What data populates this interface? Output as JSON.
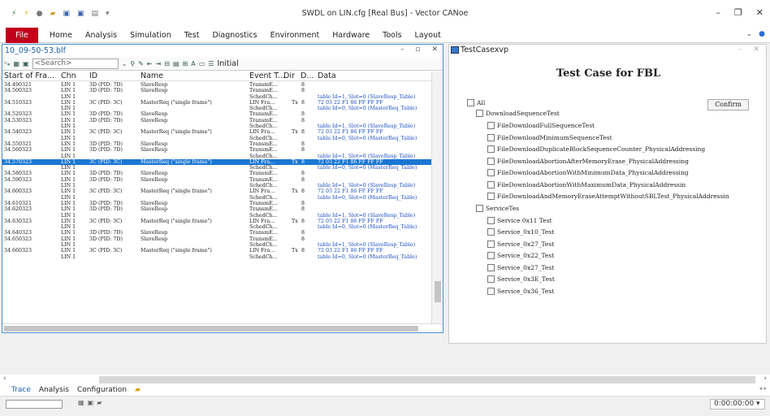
{
  "window": {
    "title": "SWDL on LIN.cfg [Real Bus] - Vector CANoe"
  },
  "menu": [
    "File",
    "Home",
    "Analysis",
    "Simulation",
    "Test",
    "Diagnostics",
    "Environment",
    "Hardware",
    "Tools",
    "Layout"
  ],
  "trace": {
    "title": "10_09-50-53.blf",
    "search_placeholder": "<Search>",
    "initial_label": "Initial",
    "columns": [
      "Start of Fra...",
      "Chn",
      "ID",
      "Name",
      "Event T...",
      "Dir",
      "D...",
      "Data"
    ],
    "rows": [
      {
        "t": "34.490321",
        "chn": "LIN 1",
        "id": "3D (PID: 7D)",
        "name": "SlaveResp",
        "evt": "TransmE...",
        "dir": "",
        "dlc": "8",
        "data": ""
      },
      {
        "t": "34.500323",
        "chn": "LIN 1",
        "id": "3D (PID: 7D)",
        "name": "SlaveResp",
        "evt": "TransmE...",
        "dir": "",
        "dlc": "8",
        "data": ""
      },
      {
        "t": "",
        "chn": "LIN 1",
        "id": "",
        "name": "",
        "evt": "SchedCh...",
        "dir": "",
        "dlc": "",
        "data": "table Id=1, Slot=0 (SlaveResp_Table)"
      },
      {
        "t": "34.510323",
        "chn": "LIN 1",
        "id": "3C (PID: 3C)",
        "name": "MasterReq (\"single frame\")",
        "evt": "LIN Fra...",
        "dir": "Tx",
        "dlc": "8",
        "data": "72 03 22 F1 86 FF FF FF"
      },
      {
        "t": "",
        "chn": "LIN 1",
        "id": "",
        "name": "",
        "evt": "SchedCh...",
        "dir": "",
        "dlc": "",
        "data": "table Id=0, Slot=0 (MasterReq_Table)"
      },
      {
        "t": "34.520323",
        "chn": "LIN 1",
        "id": "3D (PID: 7D)",
        "name": "SlaveResp",
        "evt": "TransmE...",
        "dir": "",
        "dlc": "8",
        "data": ""
      },
      {
        "t": "34.530323",
        "chn": "LIN 1",
        "id": "3D (PID: 7D)",
        "name": "SlaveResp",
        "evt": "TransmE...",
        "dir": "",
        "dlc": "8",
        "data": ""
      },
      {
        "t": "",
        "chn": "LIN 1",
        "id": "",
        "name": "",
        "evt": "SchedCh...",
        "dir": "",
        "dlc": "",
        "data": "table Id=1, Slot=0 (SlaveResp_Table)"
      },
      {
        "t": "34.540323",
        "chn": "LIN 1",
        "id": "3C (PID: 3C)",
        "name": "MasterReq (\"single frame\")",
        "evt": "LIN Fra...",
        "dir": "Tx",
        "dlc": "8",
        "data": "72 03 22 F1 86 FF FF FF"
      },
      {
        "t": "",
        "chn": "LIN 1",
        "id": "",
        "name": "",
        "evt": "SchedCh...",
        "dir": "",
        "dlc": "",
        "data": "table Id=0, Slot=0 (MasterReq_Table)"
      },
      {
        "t": "34.550321",
        "chn": "LIN 1",
        "id": "3D (PID: 7D)",
        "name": "SlaveResp",
        "evt": "TransmE...",
        "dir": "",
        "dlc": "8",
        "data": ""
      },
      {
        "t": "34.560323",
        "chn": "LIN 1",
        "id": "3D (PID: 7D)",
        "name": "SlaveResp",
        "evt": "TransmE...",
        "dir": "",
        "dlc": "8",
        "data": ""
      },
      {
        "t": "",
        "chn": "LIN 1",
        "id": "",
        "name": "",
        "evt": "SchedCh...",
        "dir": "",
        "dlc": "",
        "data": "table Id=1, Slot=0 (SlaveResp_Table)"
      },
      {
        "t": "34.570323",
        "chn": "LIN 1",
        "id": "3C (PID: 3C)",
        "name": "MasterReq (\"single frame\")",
        "evt": "LIN Fra...",
        "dir": "Tx",
        "dlc": "8",
        "data": "72 03 22 F1 86 FF FF FF",
        "selected": true
      },
      {
        "t": "",
        "chn": "LIN 1",
        "id": "",
        "name": "",
        "evt": "SchedCh...",
        "dir": "",
        "dlc": "",
        "data": "table Id=0, Slot=0 (MasterReq_Table)"
      },
      {
        "t": "34.580323",
        "chn": "LIN 1",
        "id": "3D (PID: 7D)",
        "name": "SlaveResp",
        "evt": "TransmE...",
        "dir": "",
        "dlc": "8",
        "data": ""
      },
      {
        "t": "34.590323",
        "chn": "LIN 1",
        "id": "3D (PID: 7D)",
        "name": "SlaveResp",
        "evt": "TransmE...",
        "dir": "",
        "dlc": "8",
        "data": ""
      },
      {
        "t": "",
        "chn": "LIN 1",
        "id": "",
        "name": "",
        "evt": "SchedCh...",
        "dir": "",
        "dlc": "",
        "data": "table Id=1, Slot=0 (SlaveResp_Table)"
      },
      {
        "t": "34.600323",
        "chn": "LIN 1",
        "id": "3C (PID: 3C)",
        "name": "MasterReq (\"single frame\")",
        "evt": "LIN Fra...",
        "dir": "Tx",
        "dlc": "8",
        "data": "72 03 22 F1 86 FF FF FF"
      },
      {
        "t": "",
        "chn": "LIN 1",
        "id": "",
        "name": "",
        "evt": "SchedCh...",
        "dir": "",
        "dlc": "",
        "data": "table Id=0, Slot=0 (MasterReq_Table)"
      },
      {
        "t": "34.610321",
        "chn": "LIN 1",
        "id": "3D (PID: 7D)",
        "name": "SlaveResp",
        "evt": "TransmE...",
        "dir": "",
        "dlc": "8",
        "data": ""
      },
      {
        "t": "34.620323",
        "chn": "LIN 1",
        "id": "3D (PID: 7D)",
        "name": "SlaveResp",
        "evt": "TransmE...",
        "dir": "",
        "dlc": "8",
        "data": ""
      },
      {
        "t": "",
        "chn": "LIN 1",
        "id": "",
        "name": "",
        "evt": "SchedCh...",
        "dir": "",
        "dlc": "",
        "data": "table Id=1, Slot=0 (SlaveResp_Table)"
      },
      {
        "t": "34.630323",
        "chn": "LIN 1",
        "id": "3C (PID: 3C)",
        "name": "MasterReq (\"single frame\")",
        "evt": "LIN Fra...",
        "dir": "Tx",
        "dlc": "8",
        "data": "72 03 22 F1 86 FF FF FF"
      },
      {
        "t": "",
        "chn": "LIN 1",
        "id": "",
        "name": "",
        "evt": "SchedCh...",
        "dir": "",
        "dlc": "",
        "data": "table Id=0, Slot=0 (MasterReq_Table)"
      },
      {
        "t": "34.640323",
        "chn": "LIN 1",
        "id": "3D (PID: 7D)",
        "name": "SlaveResp",
        "evt": "TransmE...",
        "dir": "",
        "dlc": "8",
        "data": ""
      },
      {
        "t": "34.650323",
        "chn": "LIN 1",
        "id": "3D (PID: 7D)",
        "name": "SlaveResp",
        "evt": "TransmE...",
        "dir": "",
        "dlc": "8",
        "data": ""
      },
      {
        "t": "",
        "chn": "LIN 1",
        "id": "",
        "name": "",
        "evt": "SchedCh...",
        "dir": "",
        "dlc": "",
        "data": "table Id=1, Slot=0 (SlaveResp_Table)"
      },
      {
        "t": "34.660323",
        "chn": "LIN 1",
        "id": "3C (PID: 3C)",
        "name": "MasterReq (\"single frame\")",
        "evt": "LIN Fra...",
        "dir": "Tx",
        "dlc": "8",
        "data": "72 03 22 F1 86 FF FF FF"
      },
      {
        "t": "",
        "chn": "LIN 1",
        "id": "",
        "name": "",
        "evt": "SchedCh...",
        "dir": "",
        "dlc": "",
        "data": "table Id=0, Slot=0 (MasterReq_Table)"
      }
    ]
  },
  "testcase": {
    "window_title": "TestCasexvp",
    "heading": "Test Case for FBL",
    "confirm_label": "Confirm",
    "all_label": "All",
    "groups": [
      {
        "label": "DownloadSequenceTest",
        "items": [
          "FileDownloadFullSequenceTest",
          "FileDownloadMinimumSequenceTest",
          "FileDownloadDuplicateBlockSequenceCounter_PhysicalAddressing",
          "FileDownloadAbortionAfterMemoryErase_PhysicalAddressing",
          "FileDownloadAbortionWithMinimumData_PhysicalAddressing",
          "FileDownloadAbortionWithMaximumData_PhysicalAddressin",
          "FileDownloadAndMemoryEraseAttemptWithoutSBLTest_PhysicalAddressin"
        ]
      },
      {
        "label": "ServiceTes",
        "items": [
          "Service 0x11 Test",
          "Service_0x10_Test",
          "Service_0x27_Test",
          "Service_0x22_Test",
          "Service_0x27_Test",
          "Service_0x3E_Test",
          "Service_0x36_Test"
        ]
      }
    ]
  },
  "bottom_tabs": [
    "Trace",
    "Analysis",
    "Configuration"
  ],
  "status": {
    "time": "0:00:00:00"
  },
  "colors": {
    "accent": "#c3001b",
    "selection": "#1977d3",
    "link": "#1b5fa8"
  }
}
